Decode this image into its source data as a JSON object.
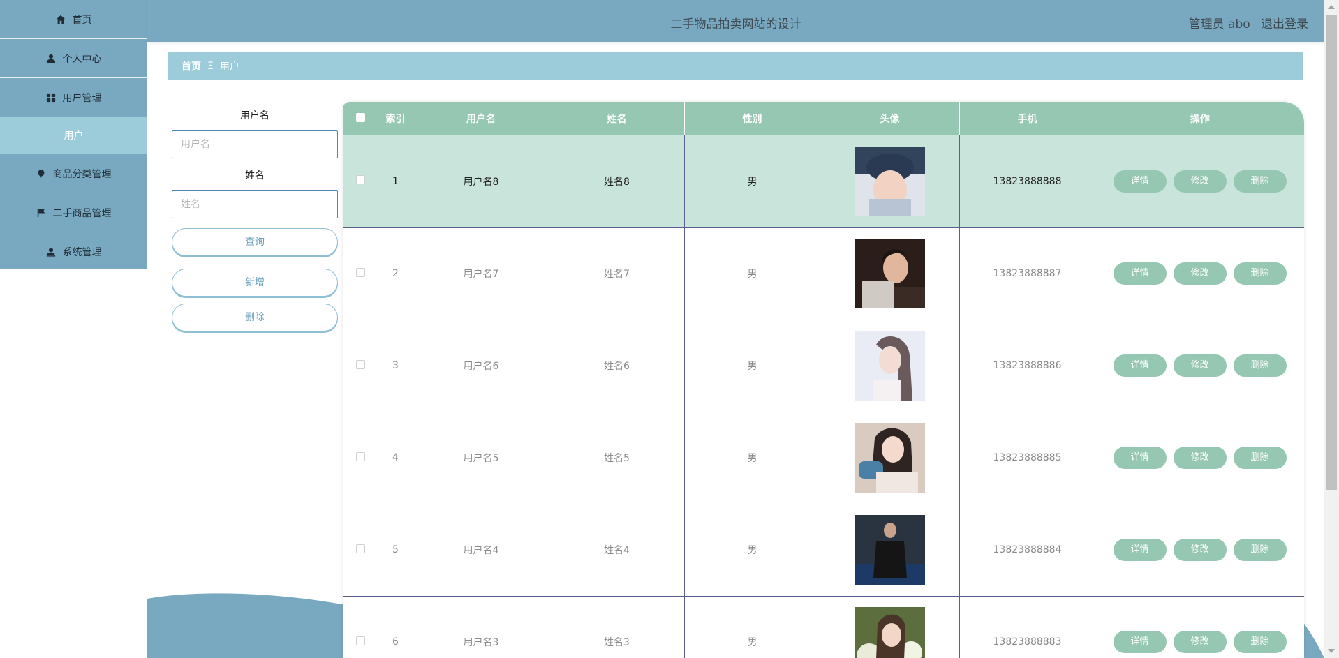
{
  "header": {
    "title": "二手物品拍卖网站的设计",
    "user_label": "管理员 abo",
    "logout_label": "退出登录"
  },
  "sidebar": {
    "items": [
      {
        "label": "首页",
        "icon": "home-icon"
      },
      {
        "label": "个人中心",
        "icon": "user-icon"
      },
      {
        "label": "用户管理",
        "icon": "grid-icon"
      },
      {
        "label": "用户",
        "icon": ""
      },
      {
        "label": "商品分类管理",
        "icon": "balloon-icon"
      },
      {
        "label": "二手商品管理",
        "icon": "flag-icon"
      },
      {
        "label": "系统管理",
        "icon": "person-icon"
      }
    ]
  },
  "breadcrumb": {
    "home": "首页",
    "separator": "Ξ",
    "current": "用户"
  },
  "search": {
    "username_label": "用户名",
    "username_placeholder": "用户名",
    "name_label": "姓名",
    "name_placeholder": "姓名",
    "query_button": "查询",
    "add_button": "新增",
    "delete_button": "删除"
  },
  "table": {
    "columns": [
      "索引",
      "用户名",
      "姓名",
      "性别",
      "头像",
      "手机",
      "操作"
    ],
    "action_labels": {
      "detail": "详情",
      "edit": "修改",
      "delete": "删除"
    },
    "rows": [
      {
        "index": "1",
        "username": "用户名8",
        "name": "姓名8",
        "gender": "男",
        "phone": "13823888888"
      },
      {
        "index": "2",
        "username": "用户名7",
        "name": "姓名7",
        "gender": "男",
        "phone": "13823888887"
      },
      {
        "index": "3",
        "username": "用户名6",
        "name": "姓名6",
        "gender": "男",
        "phone": "13823888886"
      },
      {
        "index": "4",
        "username": "用户名5",
        "name": "姓名5",
        "gender": "男",
        "phone": "13823888885"
      },
      {
        "index": "5",
        "username": "用户名4",
        "name": "姓名4",
        "gender": "男",
        "phone": "13823888884"
      },
      {
        "index": "6",
        "username": "用户名3",
        "name": "姓名3",
        "gender": "男",
        "phone": "13823888883"
      }
    ]
  },
  "colors": {
    "primary": "#79a9c1",
    "light": "#9ccbd9",
    "table_header": "#95c7b3",
    "highlight_row": "#c9e4da"
  }
}
